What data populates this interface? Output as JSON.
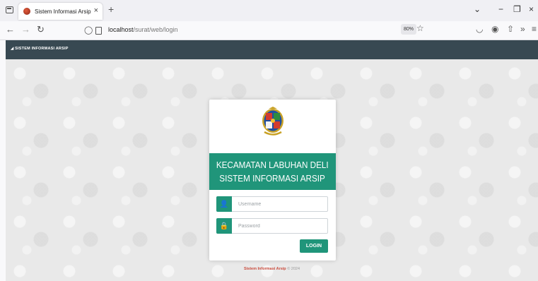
{
  "browser": {
    "tab_title": "Sistem Informasi Arsip",
    "tab_close": "×",
    "new_tab": "+",
    "url_host": "localhost",
    "url_path": "/surat/web/login",
    "zoom": "80%",
    "min": "−",
    "restore": "❐",
    "close": "×",
    "list_all": "⌄"
  },
  "app": {
    "header_title": "SISTEM INFORMASI ARSIP"
  },
  "login": {
    "line1": "KECAMATAN LABUHAN DELI",
    "line2": "SISTEM INFORMASI ARSIP",
    "username_placeholder": "Username",
    "password_placeholder": "Password",
    "button_label": "LOGIN"
  },
  "footer": {
    "brand": "Sistem Informasi Arsip",
    "year": " © 2024"
  },
  "colors": {
    "accent": "#20957a",
    "header": "#384952"
  }
}
